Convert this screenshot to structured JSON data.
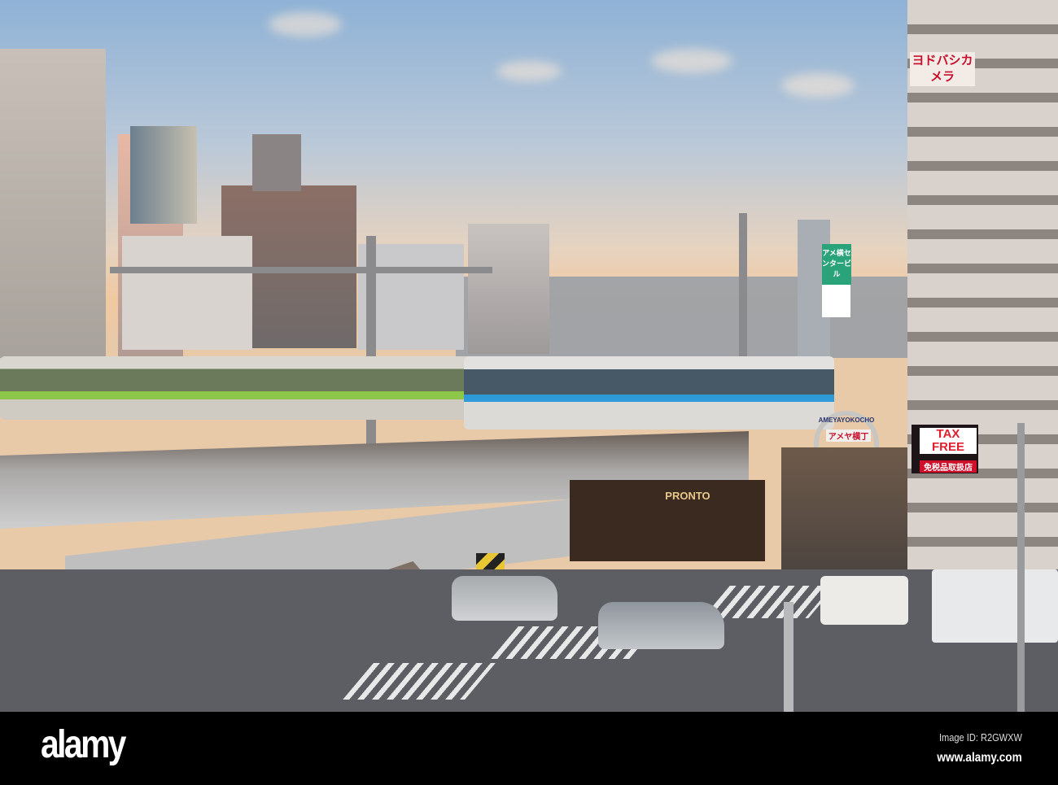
{
  "photo": {
    "subject": "Ueno station train viaduct and Ameyoko market street",
    "signs": {
      "yodobashi": "ヨドバシカメラ",
      "ameyoko_arch": "AMEYAYOKOCHO",
      "ameyoko_jp": "アメヤ横丁",
      "tax_free": "TAX FREE",
      "tax_free_jp": "免税品取扱店",
      "cafe": "PRONTO",
      "ame_center": "アメ横センタービル"
    }
  },
  "watermark": {
    "logo": "alamy",
    "image_id": "Image ID: R2GWXW",
    "url": "www.alamy.com"
  }
}
